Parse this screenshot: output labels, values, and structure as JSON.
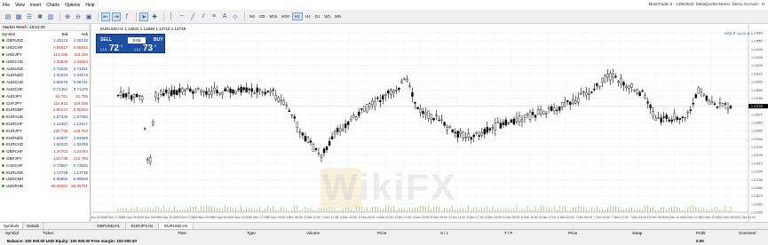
{
  "menu": {
    "items": [
      "File",
      "View",
      "Insert",
      "Charts",
      "Options",
      "Help"
    ]
  },
  "window_title": "MetaTrader 5 - 13663632: MetaQuotes-Demo: Demo Account - H",
  "timeframes": [
    "M1",
    "M5",
    "M15",
    "M30",
    "H1",
    "H4",
    "D1",
    "W1",
    "MN"
  ],
  "active_timeframe": "H1",
  "market_watch": {
    "title": "Market Watch: 15:51:20",
    "headers": {
      "symbol": "Symbol",
      "bid": "Bid",
      "ask": "Ask"
    },
    "rows": [
      {
        "symbol": "GBPUSD",
        "bid": "1.26113",
        "ask": "1.26130",
        "color": "#1f3fa0"
      },
      {
        "symbol": "USDCHF",
        "bid": "0.96917",
        "ask": "0.96932",
        "color": "#c81e1e"
      },
      {
        "symbol": "USDJPY",
        "bid": "113.190",
        "ask": "113.205",
        "color": "#c81e1e"
      },
      {
        "symbol": "USDCAD",
        "bid": "1.33846",
        "ask": "1.33863",
        "color": "#c81e1e"
      },
      {
        "symbol": "AUDUSD",
        "bid": "0.73232",
        "ask": "0.73251",
        "color": "#1f3fa0"
      },
      {
        "symbol": "AUDNZD",
        "bid": "1.04623",
        "ask": "1.04673",
        "color": "#1f3fa0"
      },
      {
        "symbol": "AUDCAD",
        "bid": "0.96675",
        "ask": "0.96721",
        "color": "#1f3fa0"
      },
      {
        "symbol": "AUDCHF",
        "bid": "0.71451",
        "ask": "0.71476",
        "color": "#1f3fa0"
      },
      {
        "symbol": "AUDJPY",
        "bid": "81.761",
        "ask": "81.786",
        "color": "#c81e1e"
      },
      {
        "symbol": "CHFJPY",
        "bid": "116.813",
        "ask": "116.836",
        "color": "#c81e1e"
      },
      {
        "symbol": "EURGBP",
        "bid": "0.90172",
        "ask": "0.90184",
        "color": "#c81e1e"
      },
      {
        "symbol": "EURAUD",
        "bid": "1.57420",
        "ask": "1.57450",
        "color": "#1f3fa0"
      },
      {
        "symbol": "EURCHF",
        "bid": "1.12497",
        "ask": "1.12517",
        "color": "#1f3fa0"
      },
      {
        "symbol": "EURJPY",
        "bid": "128.730",
        "ask": "128.763",
        "color": "#c81e1e"
      },
      {
        "symbol": "EURNZD",
        "bid": "1.64807",
        "ask": "1.64829",
        "color": "#1f3fa0"
      },
      {
        "symbol": "EURCAD",
        "bid": "1.52222",
        "ask": "1.52255",
        "color": "#1f3fa0"
      },
      {
        "symbol": "GBPCHF",
        "bid": "1.24762",
        "ask": "1.24784",
        "color": "#c81e1e"
      },
      {
        "symbol": "GBPJPY",
        "bid": "142.739",
        "ask": "142.769",
        "color": "#c81e1e"
      },
      {
        "symbol": "CADCHF",
        "bid": "0.73887",
        "ask": "0.73922",
        "color": "#1f3fa0"
      },
      {
        "symbol": "EURUSD",
        "bid": "1.13728",
        "ask": "1.13738",
        "color": "#1f3fa0"
      },
      {
        "symbol": "USDCNH",
        "bid": "6.89692",
        "ask": "6.89828",
        "color": "#1f3fa0"
      },
      {
        "symbol": "USDRUB",
        "bid": "66.39391",
        "ask": "66.39751",
        "color": "#c81e1e"
      }
    ],
    "tabs": [
      "Symbols",
      "Details"
    ]
  },
  "chart": {
    "header": "EURUSD,H1  1.13831  1.13868  1.13715  1.13728",
    "trade": {
      "sell": "SELL",
      "buy": "BUY",
      "volume": "0.00",
      "sell_prefix": "1.13",
      "sell_big": "72",
      "sell_sup": "8",
      "buy_prefix": "1.13",
      "buy_big": "73",
      "buy_sup": "8"
    },
    "tabs": [
      "GBPUSD,H1",
      "EURJPY,H1",
      "EURUSD,H1"
    ],
    "active_tab": "EURUSD,H1",
    "price_labels": [
      "1.14665",
      "1.14555",
      "1.14445",
      "1.14335",
      "1.14225",
      "1.14115",
      "1.14005",
      "1.13895",
      "1.13785",
      "1.13728",
      "1.13675",
      "1.13565",
      "1.13455",
      "1.13345",
      "1.13235",
      "1.13125",
      "1.13015",
      "1.12905",
      "1.12795",
      "1.12685",
      "1.12575",
      "1.12465",
      "1.12355"
    ],
    "time_labels": [
      "28 Nov 11:00",
      "28 Nov 17:00",
      "28 Nov 23:00",
      "29 Nov 05:00",
      "29 Nov 11:00",
      "29 Nov 17:00",
      "29 Nov 23:00",
      "30 Nov 05:00",
      "30 Nov 11:00",
      "30 Nov 17:00",
      "30 Nov 23:00",
      "3 Dec 05:00",
      "3 Dec 11:00",
      "3 Dec 17:00",
      "3 Dec 23:00",
      "4 Dec 05:00",
      "4 Dec 11:00",
      "4 Dec 17:00",
      "4 Dec 23:00",
      "5 Dec 05:00",
      "5 Dec 11:00",
      "5 Dec 17:00",
      "5 Dec 23:00",
      "6 Dec 05:00",
      "6 Dec 11:00",
      "6 Dec 17:00",
      "6 Dec 23:00",
      "7 Dec 05:00",
      "7 Dec 11:00",
      "7 Dec 17:00",
      "7 Dec 23:00",
      "10 Dec 05:00",
      "10 Dec 11:00",
      "10 Dec 17:00",
      "10 Dec 23:00",
      "11 Dec 05:00",
      "11 Dec 11:00"
    ],
    "watermark": "WikiFX",
    "mql5_label": "MQL5 commu..."
  },
  "terminal": {
    "headers": [
      "Symbol",
      "Ticket",
      "Time",
      "Type",
      "Volume",
      "Price",
      "S / L",
      "T / P",
      "Price",
      "Swap",
      "Profit",
      "Comment"
    ],
    "balance": "Balance: 100 000.00 USD  Equity: 100 000.00  Free margin: 100 000.00",
    "profit": "0.00"
  },
  "colors": {
    "bid_up": "#1f3fa0",
    "bid_down": "#c81e1e",
    "trade_panel": "#1d4fa3"
  }
}
